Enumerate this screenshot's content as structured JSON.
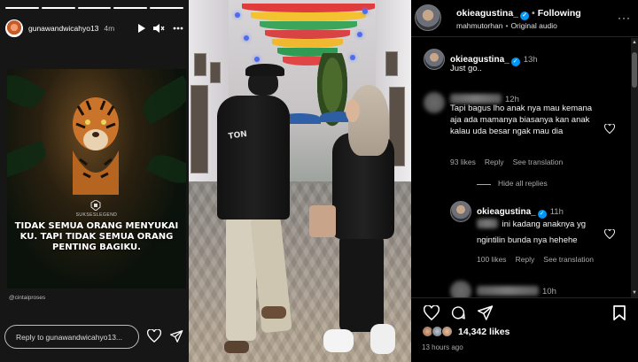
{
  "story": {
    "username": "gunawandwicahyo13",
    "time": "4m",
    "progress_segments": [
      1,
      1,
      1,
      1,
      1
    ],
    "poster": {
      "brand": "SUKSESLEGEND",
      "quote": "TIDAK SEMUA ORANG MENYUKAI KU. TAPI TIDAK SEMUA ORANG PENTING BAGIKU."
    },
    "credit": "@cintaiproses",
    "reply_placeholder": "Reply to gunawandwicahyo13...",
    "icons": [
      "play-icon",
      "mute-icon",
      "more-icon",
      "heart-icon",
      "send-icon"
    ]
  },
  "photo": {
    "jacket_print": "TON"
  },
  "post": {
    "username": "okieagustina_",
    "following_label": "Following",
    "audio_owner": "mahmutorhan",
    "audio_label": "Original audio",
    "more": "···",
    "caption": {
      "username": "okieagustina_",
      "time": "13h",
      "text": "Just go.."
    },
    "comments": [
      {
        "time": "12h",
        "text": "Tapi bagus lho anak nya mau kemana aja ada mamanya biasanya kan anak kalau uda besar ngak mau dia",
        "likes": "93 likes",
        "reply_label": "Reply",
        "translate_label": "See translation"
      }
    ],
    "hide_replies": "Hide all replies",
    "reply": {
      "username": "okieagustina_",
      "time": "11h",
      "text": "ini kadang anaknya yg ngintilin bunda nya hehehe",
      "likes": "100 likes",
      "reply_label": "Reply",
      "translate_label": "See translation"
    },
    "partial_comment_time": "10h",
    "likes_count": "14,342 likes",
    "time_ago": "13 hours ago"
  },
  "colors": {
    "verified": "#0095f6",
    "secondary_text": "#a8a8a8",
    "background": "#000000"
  }
}
